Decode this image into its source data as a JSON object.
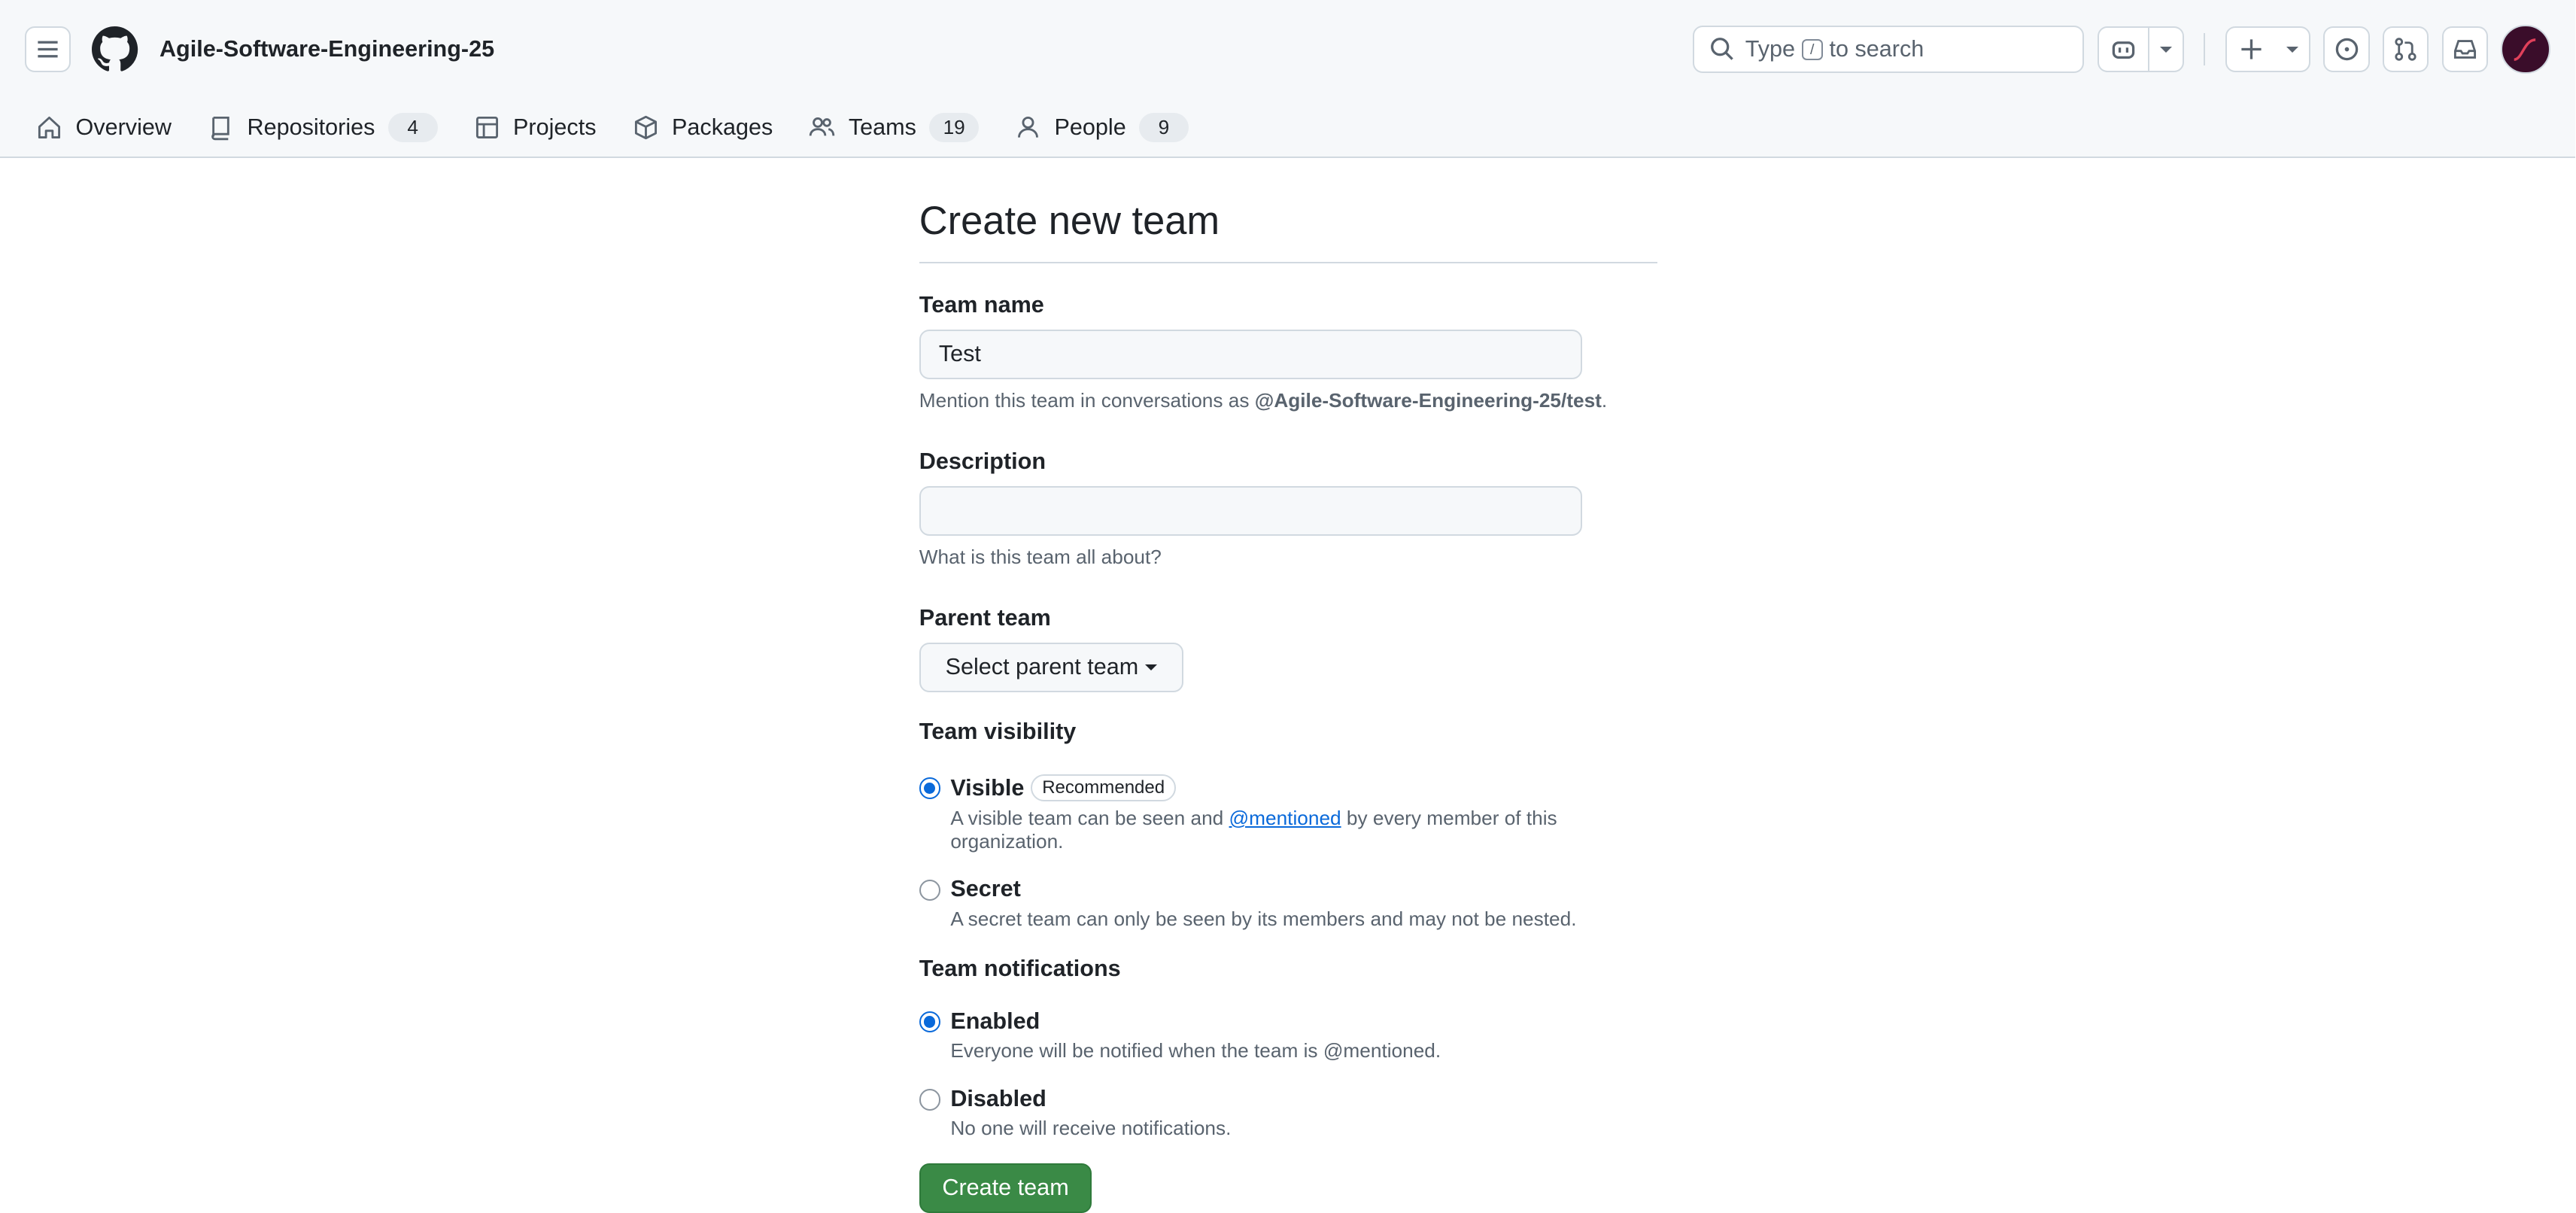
{
  "header": {
    "org_name": "Agile-Software-Engineering-25",
    "search_prefix": "Type",
    "search_key": "/",
    "search_suffix": "to search"
  },
  "nav": {
    "items": [
      {
        "label": "Overview",
        "icon": "home-icon"
      },
      {
        "label": "Repositories",
        "icon": "repo-icon",
        "count": "4"
      },
      {
        "label": "Projects",
        "icon": "table-icon"
      },
      {
        "label": "Packages",
        "icon": "package-icon"
      },
      {
        "label": "Teams",
        "icon": "people-icon",
        "count": "19"
      },
      {
        "label": "People",
        "icon": "person-icon",
        "count": "9"
      }
    ]
  },
  "form": {
    "title": "Create new team",
    "team_name_label": "Team name",
    "team_name_value": "Test",
    "mention_prefix": "Mention this team in conversations as",
    "mention_handle": "@Agile-Software-Engineering-25/test",
    "mention_suffix": ".",
    "description_label": "Description",
    "description_value": "",
    "description_note": "What is this team all about?",
    "parent_label": "Parent team",
    "parent_button": "Select parent team",
    "visibility_label": "Team visibility",
    "visible_title": "Visible",
    "visible_badge": "Recommended",
    "visible_note_prefix": "A visible team can be seen and",
    "visible_note_link": "@mentioned",
    "visible_note_suffix": "by every member of this organization.",
    "secret_title": "Secret",
    "secret_note": "A secret team can only be seen by its members and may not be nested.",
    "notifications_label": "Team notifications",
    "enabled_title": "Enabled",
    "enabled_note": "Everyone will be notified when the team is @mentioned.",
    "disabled_title": "Disabled",
    "disabled_note": "No one will receive notifications.",
    "submit_label": "Create team",
    "visibility_selected": "Visible",
    "notifications_selected": "Enabled"
  },
  "colors": {
    "accent": "#0969da",
    "primary_button": "#3a8a46"
  }
}
